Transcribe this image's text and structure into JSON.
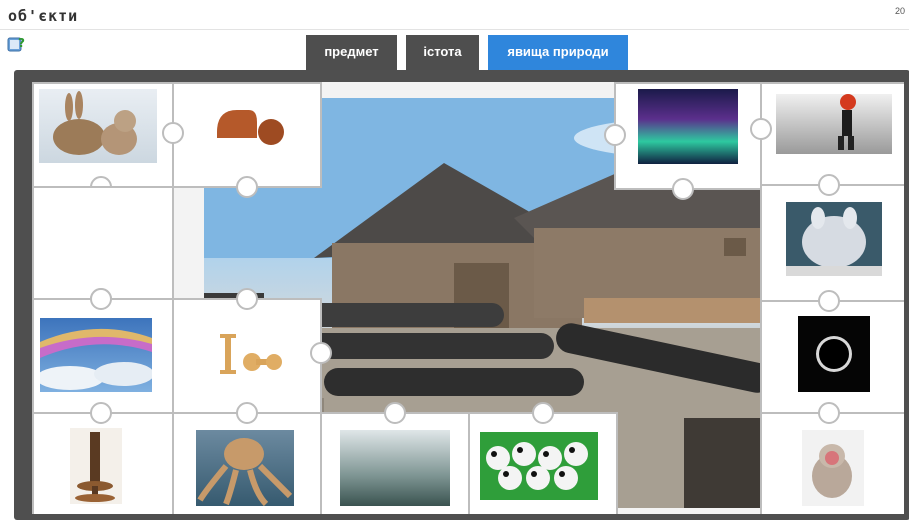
{
  "header": {
    "title": "об'єкти",
    "counter": "20"
  },
  "help": {
    "icon": "help-book-icon"
  },
  "tabs": [
    {
      "label": "предмет",
      "active": false
    },
    {
      "label": "істота",
      "active": false
    },
    {
      "label": "явища природи",
      "active": true
    }
  ],
  "colors": {
    "tab_dark": "#4e4e4e",
    "tab_active": "#2f86dc",
    "board": "#4f4f4f"
  },
  "background_photo": {
    "subject": "wooden fortress with cannons"
  },
  "pieces": [
    {
      "name": "rabbit-and-cat",
      "category": "істота"
    },
    {
      "name": "wooden-chairs",
      "category": "предмет"
    },
    {
      "name": "empty",
      "category": ""
    },
    {
      "name": "aurora",
      "category": "явища природи"
    },
    {
      "name": "snow-walker",
      "category": "явища природи"
    },
    {
      "name": "fluffy-rabbit",
      "category": "істота"
    },
    {
      "name": "rainbow-clouds",
      "category": "явища природи"
    },
    {
      "name": "dumbbells",
      "category": "предмет"
    },
    {
      "name": "solar-eclipse",
      "category": "явища природи"
    },
    {
      "name": "wooden-stand",
      "category": "предмет"
    },
    {
      "name": "octopus",
      "category": "істота"
    },
    {
      "name": "fog-forest",
      "category": "явища природи"
    },
    {
      "name": "pandas",
      "category": "істота"
    },
    {
      "name": "snow-monkey",
      "category": "істота"
    }
  ]
}
